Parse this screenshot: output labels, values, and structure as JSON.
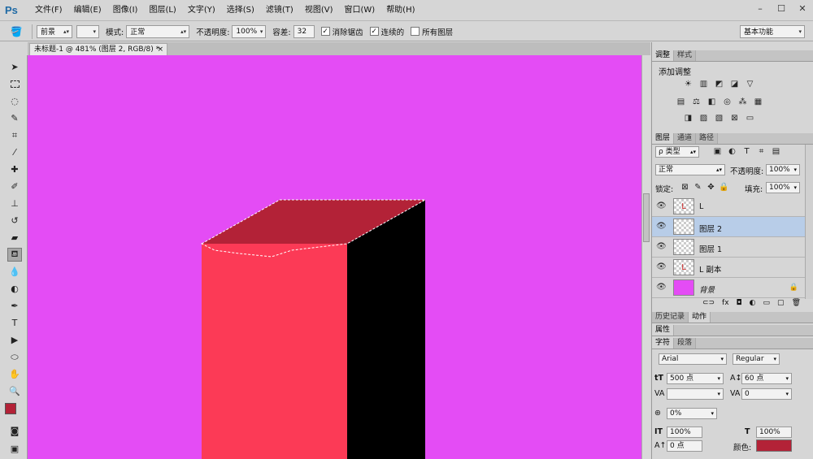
{
  "app": {
    "logo": "Ps"
  },
  "menu": [
    "文件(F)",
    "编辑(E)",
    "图像(I)",
    "图层(L)",
    "文字(Y)",
    "选择(S)",
    "滤镜(T)",
    "视图(V)",
    "窗口(W)",
    "帮助(H)"
  ],
  "window_controls": [
    "–",
    "☐",
    "✕"
  ],
  "options": {
    "fill_source": "前景",
    "mode_label": "模式:",
    "mode_value": "正常",
    "opacity_label": "不透明度:",
    "opacity_value": "100%",
    "tolerance_label": "容差:",
    "tolerance_value": "32",
    "antialias_label": "消除锯齿",
    "contiguous_label": "连续的",
    "all_layers_label": "所有图层",
    "workspace": "基本功能"
  },
  "document_tab": {
    "title": "未标题-1 @ 481% (图层 2, RGB/8) *",
    "close": "×"
  },
  "canvas": {
    "background": "#e44cf5",
    "front_face_color": "#fc3a56",
    "side_face_color": "#000000",
    "top_face_color": "#b32237"
  },
  "adjustments_panel": {
    "tabs": [
      "调整",
      "样式"
    ],
    "title": "添加调整"
  },
  "layers_panel": {
    "tabs": [
      "图层",
      "通道",
      "路径"
    ],
    "filter_kind": "ρ 类型",
    "blend_mode": "正常",
    "opacity_label": "不透明度:",
    "opacity_value": "100%",
    "lock_label": "锁定:",
    "fill_label": "填充:",
    "fill_value": "100%",
    "layers": [
      {
        "name": "L",
        "thumb": "L",
        "selected": false
      },
      {
        "name": "图层 2",
        "thumb": "",
        "selected": true
      },
      {
        "name": "图层 1",
        "thumb": "",
        "selected": false
      },
      {
        "name": "L 副本",
        "thumb": "L",
        "selected": false
      },
      {
        "name": "背景",
        "thumb": "",
        "selected": false
      }
    ]
  },
  "history_panel": {
    "tabs": [
      "历史记录",
      "动作"
    ]
  },
  "properties_panel": {
    "title": "属性"
  },
  "character_panel": {
    "tabs": [
      "字符",
      "段落"
    ],
    "font_family": "Arial",
    "font_style": "Regular",
    "font_size": "500 点",
    "leading": "60 点",
    "kerning": "",
    "tracking": "0",
    "scale_ratio": "0%",
    "vertical_scale": "100%",
    "horizontal_scale": "100%",
    "baseline_shift": "0 点",
    "color_label": "颜色:",
    "color_value": "#b32237"
  },
  "colors": {
    "foreground": "#b32237",
    "background": "#000000"
  }
}
